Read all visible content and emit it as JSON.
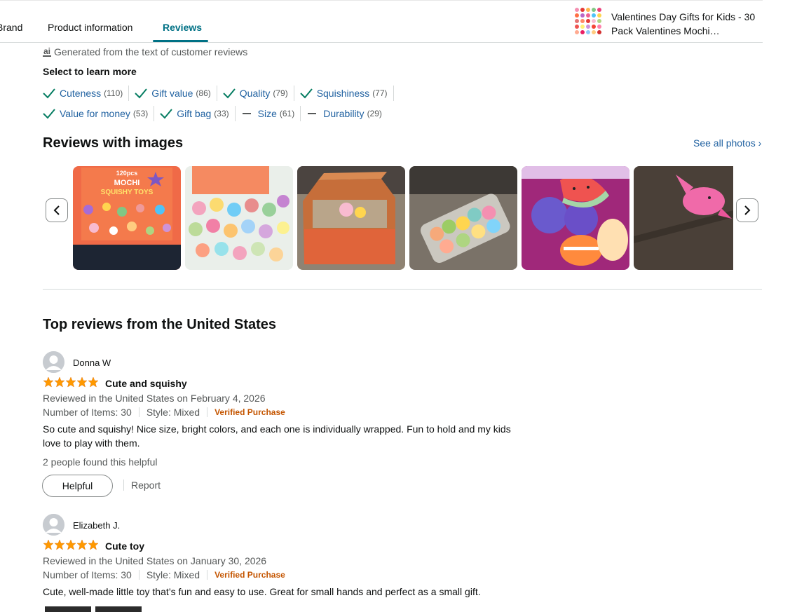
{
  "nav": {
    "tabs": [
      {
        "label": "Brand"
      },
      {
        "label": "Product information"
      },
      {
        "label": "Reviews"
      }
    ],
    "product_title": "Valentines Day Gifts for Kids - 30 Pack Valentines Mochi…"
  },
  "ai": {
    "text": "Generated from the text of customer reviews",
    "icon": "ai-icon"
  },
  "learn_more": "Select to learn more",
  "aspects": [
    {
      "label": "Cuteness",
      "count": "(110)",
      "state": "positive"
    },
    {
      "label": "Gift value",
      "count": "(86)",
      "state": "positive"
    },
    {
      "label": "Quality",
      "count": "(79)",
      "state": "positive"
    },
    {
      "label": "Squishiness",
      "count": "(77)",
      "state": "positive"
    },
    {
      "label": "Value for money",
      "count": "(53)",
      "state": "positive"
    },
    {
      "label": "Gift bag",
      "count": "(33)",
      "state": "positive"
    },
    {
      "label": "Size",
      "count": "(61)",
      "state": "mixed"
    },
    {
      "label": "Durability",
      "count": "(29)",
      "state": "mixed"
    }
  ],
  "reviews_with_images": {
    "title": "Reviews with images",
    "see_all": "See all photos",
    "photos": [
      "mochi-box-photo",
      "wrapped-toys-photo",
      "open-box-photo",
      "bagged-toys-photo",
      "squishy-fruits-photo",
      "pink-dolphin-photo"
    ],
    "box_text_1": "120pcs",
    "box_text_2": "MOCHI",
    "box_text_3": "SQUISHY TOYS"
  },
  "top_reviews": {
    "title": "Top reviews from the United States",
    "items": [
      {
        "name": "Donna W",
        "rating": 5,
        "title": "Cute and squishy",
        "date": "Reviewed in the United States on February 4, 2026",
        "items_count": "Number of Items: 30",
        "style": "Style: Mixed",
        "verified": "Verified Purchase",
        "body": "So cute and squishy! Nice size, bright colors, and each one is individually wrapped. Fun to hold and my kids love to play with them.",
        "helpful_count": "2 people found this helpful",
        "helpful_label": "Helpful",
        "report_label": "Report"
      },
      {
        "name": "Elizabeth J.",
        "rating": 5,
        "title": "Cute toy",
        "date": "Reviewed in the United States on January 30, 2026",
        "items_count": "Number of Items: 30",
        "style": "Style: Mixed",
        "verified": "Verified Purchase",
        "body": "Cute, well-made little toy that’s fun and easy to use. Great for small hands and perfect as a small gift."
      }
    ]
  },
  "colors": {
    "link": "#2162a1",
    "accent": "#007185",
    "star": "#ff9900",
    "verified": "#c45500"
  }
}
